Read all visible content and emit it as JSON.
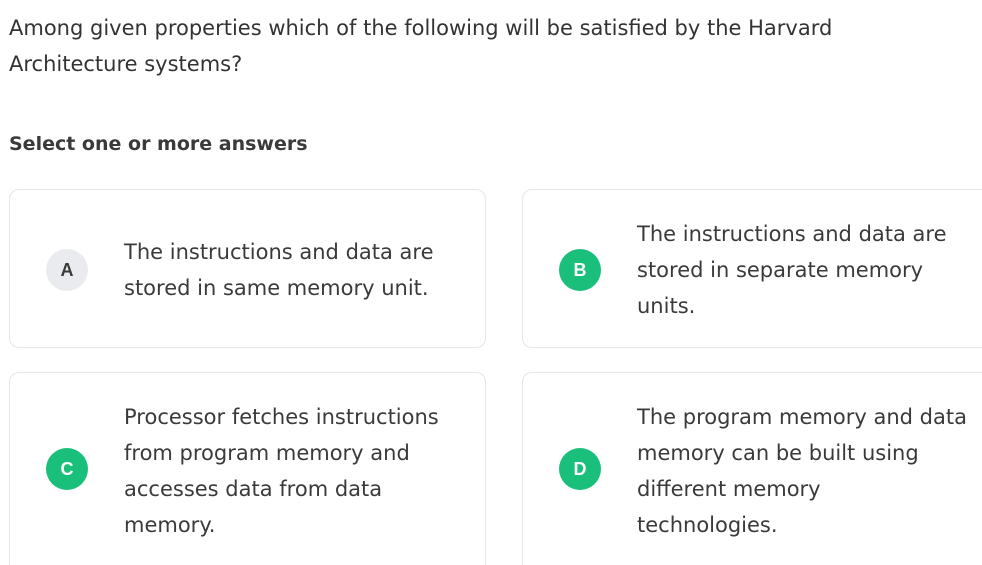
{
  "question": {
    "text": "Among given properties which of the following will be satisfied by the Harvard Architecture systems?"
  },
  "instruction": "Select one or more answers",
  "colors": {
    "selected_badge": "#1bbf7c",
    "unselected_badge": "#e9ebee",
    "card_border": "#e4e6e9"
  },
  "options": [
    {
      "letter": "A",
      "text": "The instructions and data are stored in same memory unit.",
      "selected": false
    },
    {
      "letter": "B",
      "text": "The instructions and data are stored in separate memory units.",
      "selected": true
    },
    {
      "letter": "C",
      "text": "Processor fetches instructions from program memory and accesses data from data memory.",
      "selected": true
    },
    {
      "letter": "D",
      "text": "The program memory and data memory can be built using different memory technologies.",
      "selected": true
    }
  ]
}
